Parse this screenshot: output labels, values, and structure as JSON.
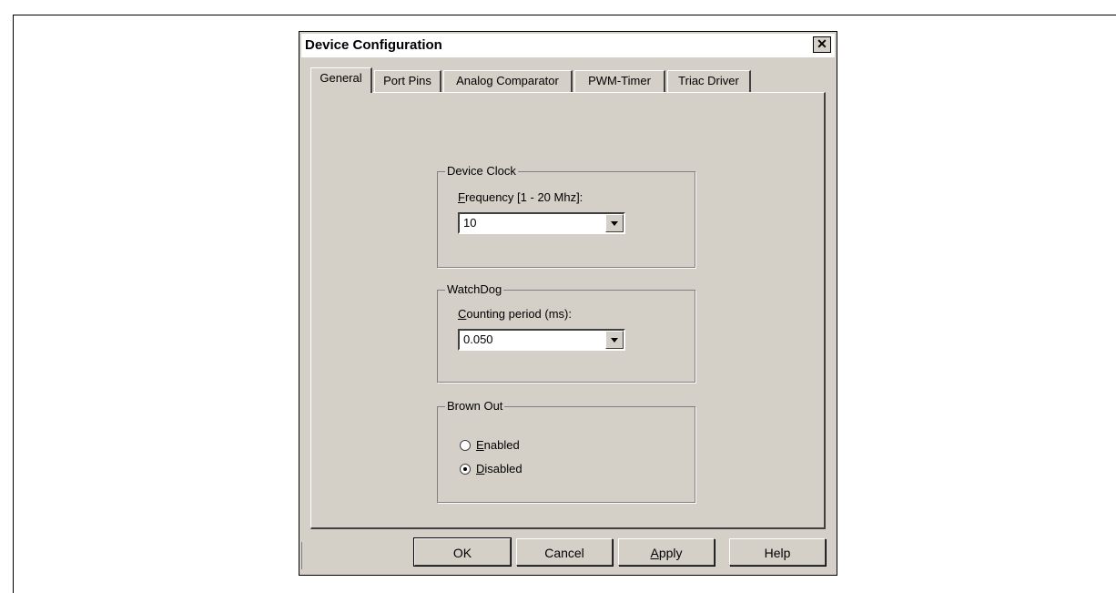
{
  "dialog": {
    "title": "Device Configuration",
    "close_glyph": "✕",
    "tabs": [
      {
        "label": "General",
        "active": true
      },
      {
        "label": "Port Pins",
        "active": false
      },
      {
        "label": "Analog Comparator",
        "active": false
      },
      {
        "label": "PWM-Timer",
        "active": false
      },
      {
        "label": "Triac Driver",
        "active": false
      }
    ]
  },
  "device_clock": {
    "title": "Device Clock",
    "label_prefix": "F",
    "label_rest": "requency [1 - 20 Mhz]:",
    "value": "10"
  },
  "watchdog": {
    "title": "WatchDog",
    "label_prefix": "C",
    "label_rest": "ounting period (ms):",
    "value": "0.050"
  },
  "brown_out": {
    "title": "Brown Out",
    "options": [
      {
        "prefix": "E",
        "rest": "nabled",
        "checked": false
      },
      {
        "prefix": "D",
        "rest": "isabled",
        "checked": true
      }
    ]
  },
  "buttons": {
    "ok": "OK",
    "cancel": "Cancel",
    "apply_prefix": "A",
    "apply_rest": "pply",
    "help": "Help"
  },
  "colors": {
    "dialog_face": "#d4d0c8",
    "border_dark": "#404040",
    "highlight": "#ffffff"
  }
}
